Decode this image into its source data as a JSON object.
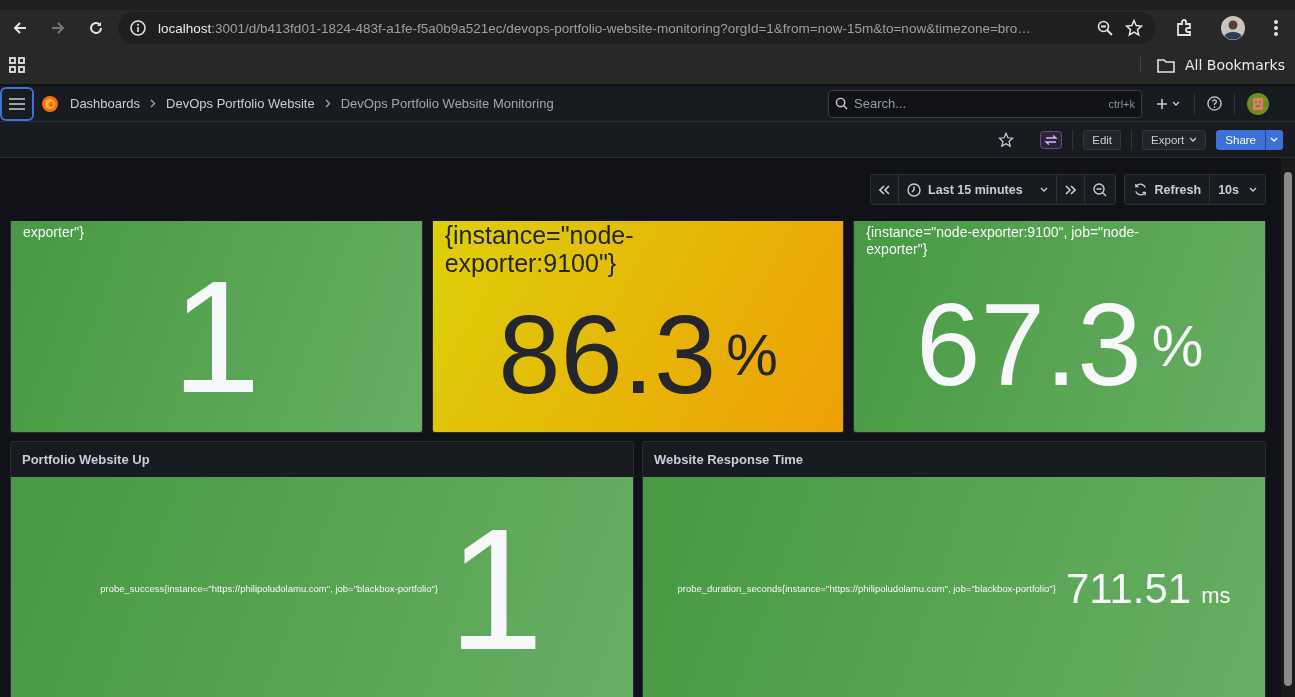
{
  "browser": {
    "url_host": "localhost",
    "url_rest": ":3001/d/b413fd01-1824-483f-a1fe-f5a0b9a521ec/devops-portfolio-website-monitoring?orgId=1&from=now-15m&to=now&timezone=bro…",
    "bookmarks_label": "All Bookmarks"
  },
  "breadcrumbs": [
    {
      "label": "Dashboards",
      "current": false
    },
    {
      "label": "DevOps Portfolio Website",
      "current": false
    },
    {
      "label": "DevOps Portfolio Website Monitoring",
      "current": true
    }
  ],
  "search": {
    "placeholder": "Search...",
    "shortcut": "ctrl+k"
  },
  "toolbar": {
    "edit": "Edit",
    "export": "Export",
    "share": "Share"
  },
  "time_controls": {
    "range": "Last 15 minutes",
    "refresh": "Refresh",
    "interval": "10s"
  },
  "panels": [
    {
      "kind": "stacked",
      "legend": "exporter\"}",
      "value": "1",
      "color": "#4a9f45"
    },
    {
      "kind": "stacked-large",
      "legend": "{instance=\"node-exporter:9100\"}",
      "value": "86.3",
      "unit": "%",
      "color": "#dcd00a"
    },
    {
      "kind": "stacked",
      "legend": "{instance=\"node-exporter:9100\", job=\"node-exporter\"}",
      "value": "67.3",
      "unit": "%",
      "color": "#4a9f45"
    },
    {
      "kind": "inline",
      "title": "Portfolio Website Up",
      "legend": "probe_success{instance=\"https://philipoludolamu.com\", job=\"blackbox-portfolio\"}",
      "value": "1",
      "color": "#4a9f45"
    },
    {
      "kind": "inline-small",
      "title": "Website Response Time",
      "legend": "probe_duration_seconds{instance=\"https://philipoludolamu.com\", job=\"blackbox-portfolio\"}",
      "value": "711.51",
      "unit": "ms",
      "color": "#4a9f45"
    }
  ]
}
